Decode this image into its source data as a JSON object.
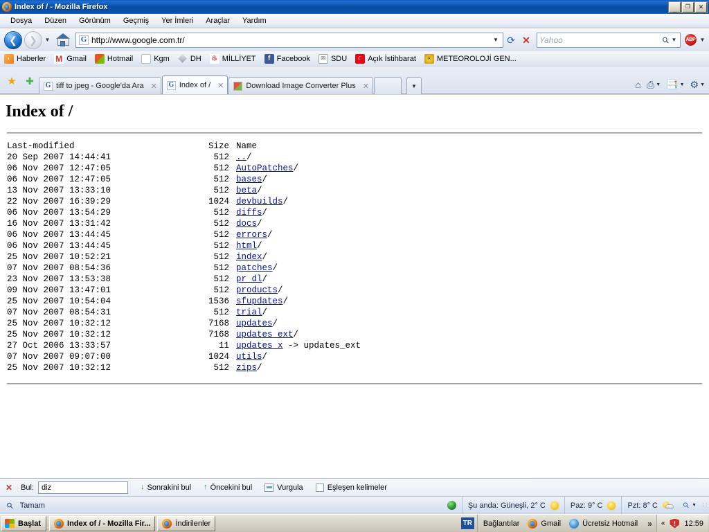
{
  "window": {
    "title": "Index of / - Mozilla Firefox",
    "minimize": "_",
    "maximize": "❐",
    "close": "✕"
  },
  "menubar": {
    "items": [
      {
        "label": "Dosya"
      },
      {
        "label": "Düzen"
      },
      {
        "label": "Görünüm"
      },
      {
        "label": "Geçmiş"
      },
      {
        "label": "Yer İmleri"
      },
      {
        "label": "Araçlar"
      },
      {
        "label": "Yardım"
      }
    ]
  },
  "navbar": {
    "back_icon": "←",
    "forward_icon": "→",
    "history_caret": "▼",
    "home_icon": "home-icon",
    "url_favicon": "G",
    "url": "http://www.google.com.tr/",
    "url_dropdown_caret": "▼",
    "reload_icon": "↻",
    "stop_icon": "✕",
    "search_placeholder": "Yahoo",
    "search_value": "",
    "search_icon": "⌕",
    "search_caret": "▼",
    "adblock_label": "ABP",
    "adblock_caret": "▼"
  },
  "bookmarks": [
    {
      "label": "Haberler",
      "icon": "rss-icon"
    },
    {
      "label": "Gmail",
      "icon": "gmail-icon"
    },
    {
      "label": "Hotmail",
      "icon": "hotmail-icon"
    },
    {
      "label": "Kgm",
      "icon": "page-icon"
    },
    {
      "label": "DH",
      "icon": "diamond-icon"
    },
    {
      "label": "MİLLİYET",
      "icon": "flame-icon"
    },
    {
      "label": "Facebook",
      "icon": "facebook-icon"
    },
    {
      "label": "SDU",
      "icon": "envelope-icon"
    },
    {
      "label": "Açık İstihbarat",
      "icon": "turkish-flag-icon"
    },
    {
      "label": "METEOROLOJİ GEN...",
      "icon": "sun-icon"
    }
  ],
  "tabbar": {
    "star_icon": "★",
    "add_bookmark_icon": "✚",
    "tabs": [
      {
        "label": "tiff to jpeg - Google'da Ara",
        "favicon": "G",
        "active": false,
        "close": "✕"
      },
      {
        "label": "Index of /",
        "favicon": "G",
        "active": true,
        "close": "✕"
      },
      {
        "label": "Download Image Converter Plus",
        "favicon": "leaf",
        "active": false,
        "close": "✕"
      }
    ],
    "tab_list_caret": "▼",
    "tools": [
      {
        "name": "home-icon",
        "glyph": "⌂",
        "caret": ""
      },
      {
        "name": "print-icon",
        "glyph": "⎙",
        "caret": "▼"
      },
      {
        "name": "notes-icon",
        "glyph": "Ὕ2",
        "caret": "▼"
      },
      {
        "name": "settings-gear-icon",
        "glyph": "⚙",
        "caret": "▼"
      }
    ]
  },
  "page": {
    "heading": "Index of /",
    "columns": {
      "date": "Last-modified",
      "size": "Size",
      "name": "Name"
    },
    "rows": [
      {
        "date": "20 Sep 2007 14:44:41",
        "size": "512",
        "name": "../",
        "link": "..",
        "suffix": "/",
        "extra": ""
      },
      {
        "date": "06 Nov 2007 12:47:05",
        "size": "512",
        "name": "AutoPatches/",
        "link": "AutoPatches",
        "suffix": "/",
        "extra": ""
      },
      {
        "date": "06 Nov 2007 12:47:05",
        "size": "512",
        "name": "bases/",
        "link": "bases",
        "suffix": "/",
        "extra": ""
      },
      {
        "date": "13 Nov 2007 13:33:10",
        "size": "512",
        "name": "beta/",
        "link": "beta",
        "suffix": "/",
        "extra": ""
      },
      {
        "date": "22 Nov 2007 16:39:29",
        "size": "1024",
        "name": "devbuilds/",
        "link": "devbuilds",
        "suffix": "/",
        "extra": ""
      },
      {
        "date": "06 Nov 2007 13:54:29",
        "size": "512",
        "name": "diffs/",
        "link": "diffs",
        "suffix": "/",
        "extra": ""
      },
      {
        "date": "16 Nov 2007 13:31:42",
        "size": "512",
        "name": "docs/",
        "link": "docs",
        "suffix": "/",
        "extra": ""
      },
      {
        "date": "06 Nov 2007 13:44:45",
        "size": "512",
        "name": "errors/",
        "link": "errors",
        "suffix": "/",
        "extra": ""
      },
      {
        "date": "06 Nov 2007 13:44:45",
        "size": "512",
        "name": "html/",
        "link": "html",
        "suffix": "/",
        "extra": ""
      },
      {
        "date": "25 Nov 2007 10:52:21",
        "size": "512",
        "name": "index/",
        "link": "index",
        "suffix": "/",
        "extra": ""
      },
      {
        "date": "07 Nov 2007 08:54:36",
        "size": "512",
        "name": "patches/",
        "link": "patches",
        "suffix": "/",
        "extra": ""
      },
      {
        "date": "23 Nov 2007 13:53:38",
        "size": "512",
        "name": "pr dl/",
        "link": "pr dl",
        "suffix": "/",
        "extra": ""
      },
      {
        "date": "09 Nov 2007 13:47:01",
        "size": "512",
        "name": "products/",
        "link": "products",
        "suffix": "/",
        "extra": ""
      },
      {
        "date": "25 Nov 2007 10:54:04",
        "size": "1536",
        "name": "sfupdates/",
        "link": "sfupdates",
        "suffix": "/",
        "extra": ""
      },
      {
        "date": "07 Nov 2007 08:54:31",
        "size": "512",
        "name": "trial/",
        "link": "trial",
        "suffix": "/",
        "extra": ""
      },
      {
        "date": "25 Nov 2007 10:32:12",
        "size": "7168",
        "name": "updates/",
        "link": "updates",
        "suffix": "/",
        "extra": ""
      },
      {
        "date": "25 Nov 2007 10:32:12",
        "size": "7168",
        "name": "updates ext/",
        "link": "updates ext",
        "suffix": "/",
        "extra": ""
      },
      {
        "date": "27 Oct 2006 13:33:57",
        "size": "11",
        "name": "updates x -> updates_ext",
        "link": "updates x",
        "suffix": "",
        "extra": " -> updates_ext"
      },
      {
        "date": "07 Nov 2007 09:07:00",
        "size": "1024",
        "name": "utils/",
        "link": "utils",
        "suffix": "/",
        "extra": ""
      },
      {
        "date": "25 Nov 2007 10:32:12",
        "size": "512",
        "name": "zips/",
        "link": "zips",
        "suffix": "/",
        "extra": ""
      }
    ]
  },
  "findbar": {
    "close_icon": "✕",
    "label": "Bul:",
    "value": "diz",
    "find_next": "Sonrakini bul",
    "find_prev": "Öncekini bul",
    "highlight": "Vurgula",
    "match_case": "Eşleşen kelimeler",
    "next_arrow": "↓",
    "prev_arrow": "↑"
  },
  "statusbar": {
    "search_icon": "⌕",
    "status": "Tamam",
    "weather": [
      {
        "label": "Şu anda: Güneşli, 2° C",
        "icon": "sun-icon"
      },
      {
        "label": "Paz: 9° C",
        "icon": "sun-icon"
      },
      {
        "label": "Pzt: 8° C",
        "icon": "partly-cloudy-icon"
      }
    ],
    "zoom_icon": "⌕",
    "zoom_caret": "▼",
    "resize_grip": "∷"
  },
  "taskbar": {
    "start": "Başlat",
    "items": [
      {
        "label": "Index of / - Mozilla Fir...",
        "icon": "firefox-icon",
        "active": true
      },
      {
        "label": "İndirilenler",
        "icon": "firefox-icon",
        "active": false
      }
    ],
    "language": "TR",
    "quicklaunch": [
      {
        "label": "Bağlantılar",
        "icon": ""
      },
      {
        "label": "Gmail",
        "icon": "firefox-icon"
      },
      {
        "label": "Ücretsiz Hotmail",
        "icon": "ie-icon"
      }
    ],
    "overflow_chevron": "»",
    "tray_chevron": "«",
    "tray_shield": "shield-icon",
    "clock": "12:59"
  },
  "colors": {
    "titlebar": "#0a4fa8",
    "link": "#00109b",
    "accent": "#2e9b2e"
  }
}
